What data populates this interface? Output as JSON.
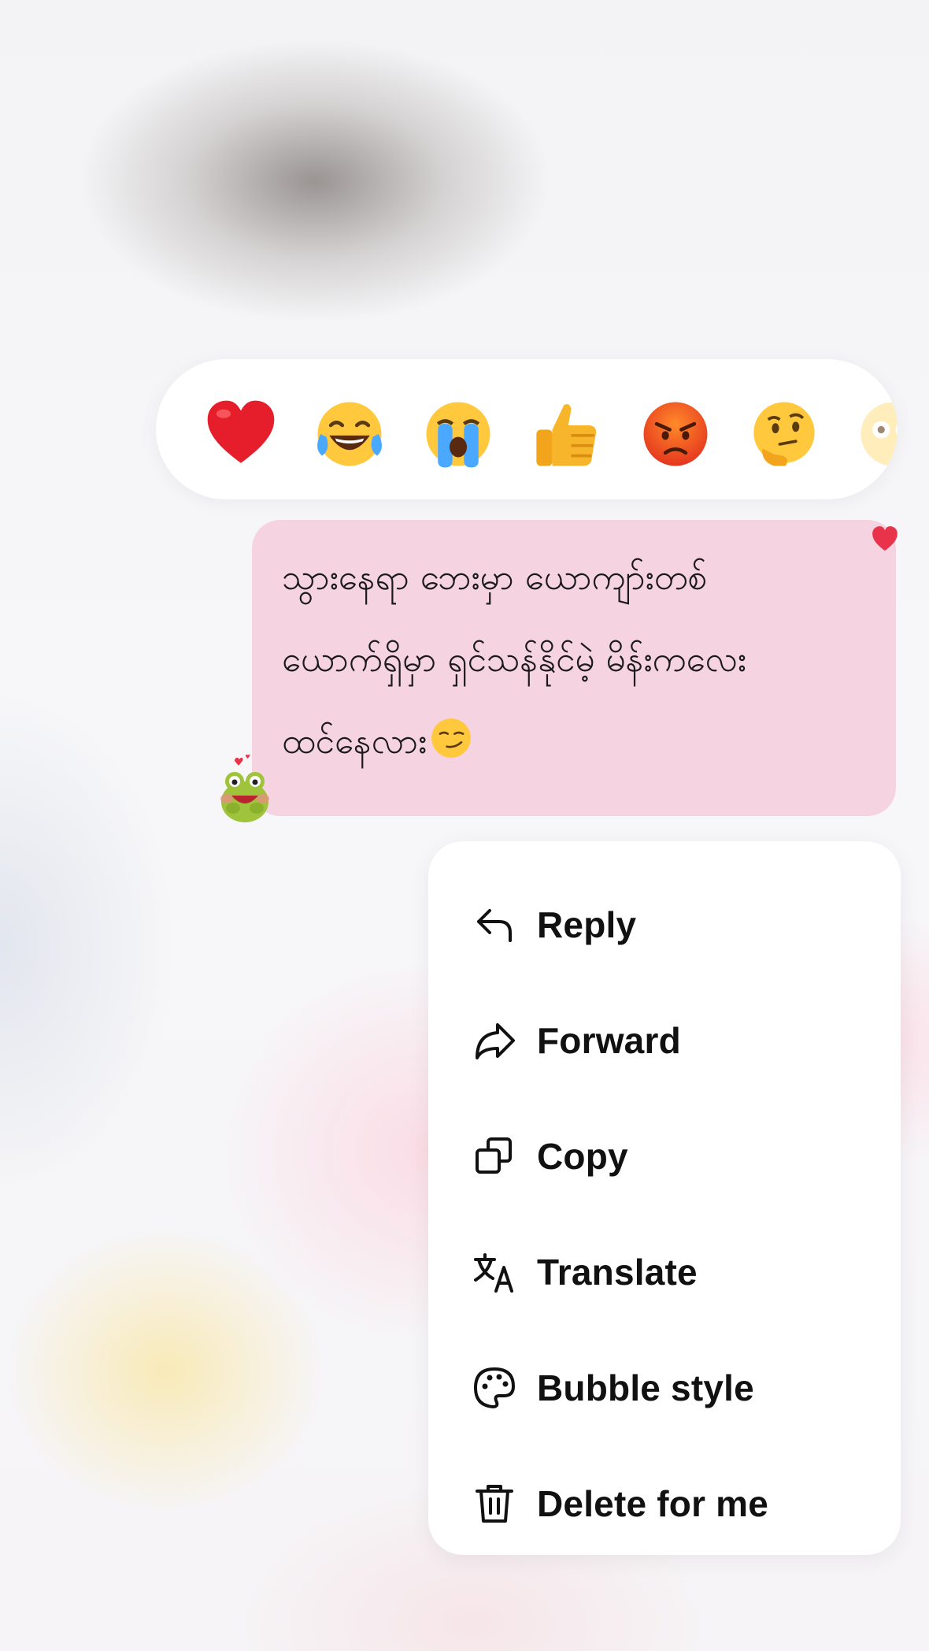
{
  "reactions": [
    {
      "icon": "red-heart-emoji"
    },
    {
      "icon": "tears-of-joy-emoji"
    },
    {
      "icon": "loudly-crying-emoji"
    },
    {
      "icon": "thumbs-up-emoji"
    },
    {
      "icon": "angry-face-emoji"
    },
    {
      "icon": "thinking-face-emoji"
    },
    {
      "icon": "flushed-face-emoji"
    }
  ],
  "message": {
    "lines": [
      "သွားနေရာ ဘေးမှာ ယောကျာ်းတစ်",
      "ယောက်ရှိမှာ ရှင်သန်နိုင်မဲ့ မိန်းကလေး",
      "ထင်နေလား"
    ],
    "trailing_emoji": "smirking-face-emoji",
    "bubble_color": "#f6d3e1",
    "liked_indicator": "heart-icon",
    "sticker": "frog-sticker"
  },
  "menu": {
    "items": [
      {
        "label": "Reply",
        "icon": "reply-icon"
      },
      {
        "label": "Forward",
        "icon": "forward-icon"
      },
      {
        "label": "Copy",
        "icon": "copy-icon"
      },
      {
        "label": "Translate",
        "icon": "translate-icon"
      },
      {
        "label": "Bubble style",
        "icon": "palette-icon"
      },
      {
        "label": "Delete for me",
        "icon": "trash-icon"
      }
    ]
  },
  "colors": {
    "accent_heart": "#e8334a",
    "menu_text": "#111111"
  }
}
